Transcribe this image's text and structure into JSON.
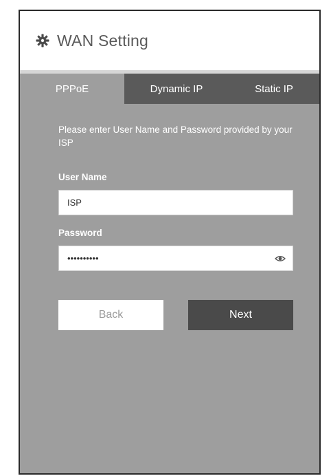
{
  "header": {
    "title": "WAN Setting",
    "icon": "gear-icon"
  },
  "tabs": [
    {
      "label": "PPPoE",
      "active": true
    },
    {
      "label": "Dynamic IP",
      "active": false
    },
    {
      "label": "Static IP",
      "active": false
    }
  ],
  "form": {
    "instructions": "Please enter User Name and Password provided by your ISP",
    "username_label": "User Name",
    "username_value": "ISP",
    "password_label": "Password",
    "password_value": "••••••••••",
    "password_toggle_icon": "eye-icon"
  },
  "actions": {
    "back_label": "Back",
    "next_label": "Next"
  },
  "colors": {
    "panel": "#9e9e9e",
    "tab_inactive": "#5a5a5a",
    "next_button": "#4a4a4a"
  }
}
